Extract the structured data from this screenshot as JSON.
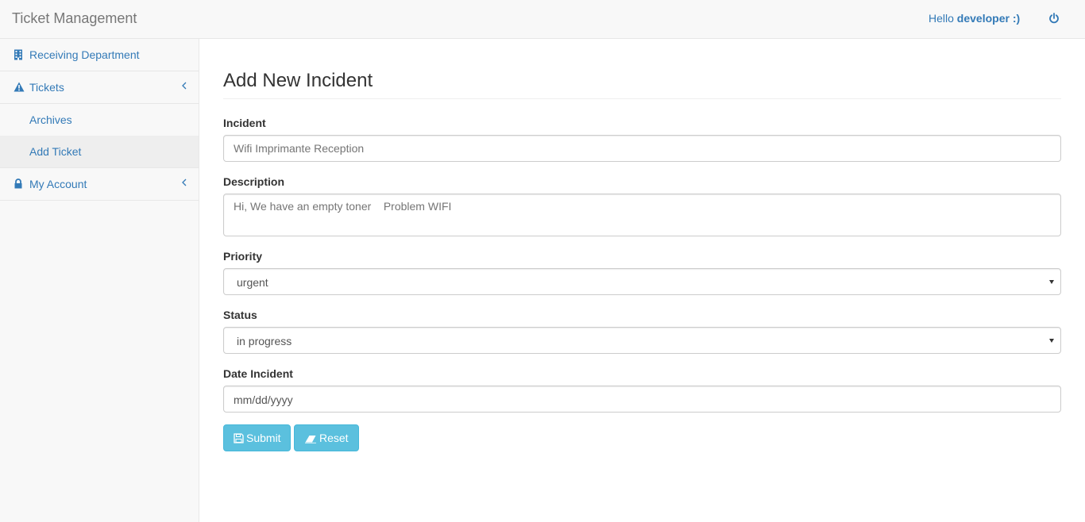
{
  "navbar": {
    "brand": "Ticket Management",
    "greeting": "Hello ",
    "username": "developer :)",
    "power_icon": "power-icon"
  },
  "sidebar": {
    "items": [
      {
        "label": "Receiving Department",
        "icon": "building-icon"
      },
      {
        "label": "Tickets",
        "icon": "warning-icon"
      },
      {
        "label": "Archives"
      },
      {
        "label": "Add Ticket"
      },
      {
        "label": "My Account",
        "icon": "lock-icon"
      }
    ]
  },
  "form": {
    "title": "Add New Incident",
    "incident_label": "Incident",
    "incident_placeholder": "Wifi Imprimante Reception",
    "description_label": "Description",
    "description_placeholder": "Hi, We have an empty toner    Problem WIFI",
    "priority_label": "Priority",
    "priority_value": "urgent",
    "status_label": "Status",
    "status_value": "in progress",
    "date_label": "Date Incident",
    "date_placeholder": "mm/dd/yyyy",
    "submit_label": "Submit",
    "reset_label": "Reset"
  },
  "colors": {
    "link": "#337ab7",
    "button": "#5bc0de",
    "navbar_bg": "#f8f8f8"
  }
}
